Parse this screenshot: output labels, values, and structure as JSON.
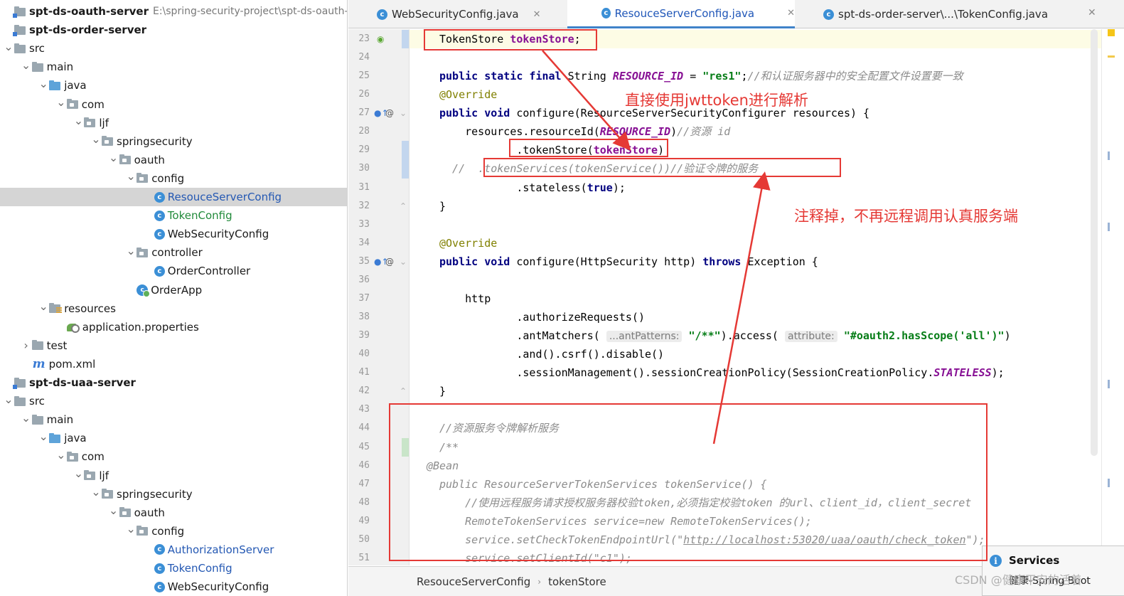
{
  "project_tree": [
    {
      "name": "spt-ds-oauth-server",
      "path": "E:\\spring-security-project\\spt-ds-oauth-serve",
      "type": "module",
      "depth": 0,
      "arrow": "",
      "bold": true
    },
    {
      "name": "spt-ds-order-server",
      "type": "module",
      "depth": 0,
      "arrow": "",
      "bold": true
    },
    {
      "name": "src",
      "type": "folder",
      "depth": 0,
      "arrow": "v"
    },
    {
      "name": "main",
      "type": "folder",
      "depth": 1,
      "arrow": "v"
    },
    {
      "name": "java",
      "type": "src",
      "depth": 2,
      "arrow": "v"
    },
    {
      "name": "com",
      "type": "pkg",
      "depth": 3,
      "arrow": "v"
    },
    {
      "name": "ljf",
      "type": "pkg",
      "depth": 4,
      "arrow": "v"
    },
    {
      "name": "springsecurity",
      "type": "pkg",
      "depth": 5,
      "arrow": "v"
    },
    {
      "name": "oauth",
      "type": "pkg",
      "depth": 6,
      "arrow": "v"
    },
    {
      "name": "config",
      "type": "pkg",
      "depth": 7,
      "arrow": "v"
    },
    {
      "name": "ResouceServerConfig",
      "type": "class",
      "depth": 8,
      "arrow": "",
      "color": "blue",
      "selected": true
    },
    {
      "name": "TokenConfig",
      "type": "class",
      "depth": 8,
      "arrow": "",
      "color": "green"
    },
    {
      "name": "WebSecurityConfig",
      "type": "class",
      "depth": 8,
      "arrow": ""
    },
    {
      "name": "controller",
      "type": "pkg",
      "depth": 7,
      "arrow": "v"
    },
    {
      "name": "OrderController",
      "type": "class",
      "depth": 8,
      "arrow": ""
    },
    {
      "name": "OrderApp",
      "type": "app",
      "depth": 7,
      "arrow": ""
    },
    {
      "name": "resources",
      "type": "res",
      "depth": 2,
      "arrow": "v"
    },
    {
      "name": "application.properties",
      "type": "props",
      "depth": 3,
      "arrow": ""
    },
    {
      "name": "test",
      "type": "folder",
      "depth": 1,
      "arrow": ">"
    },
    {
      "name": "pom.xml",
      "type": "maven",
      "depth": 1,
      "arrow": ""
    },
    {
      "name": "spt-ds-uaa-server",
      "type": "module",
      "depth": 0,
      "arrow": "",
      "bold": true
    },
    {
      "name": "src",
      "type": "folder",
      "depth": 0,
      "arrow": "v"
    },
    {
      "name": "main",
      "type": "folder",
      "depth": 1,
      "arrow": "v"
    },
    {
      "name": "java",
      "type": "src",
      "depth": 2,
      "arrow": "v"
    },
    {
      "name": "com",
      "type": "pkg",
      "depth": 3,
      "arrow": "v"
    },
    {
      "name": "ljf",
      "type": "pkg",
      "depth": 4,
      "arrow": "v"
    },
    {
      "name": "springsecurity",
      "type": "pkg",
      "depth": 5,
      "arrow": "v"
    },
    {
      "name": "oauth",
      "type": "pkg",
      "depth": 6,
      "arrow": "v"
    },
    {
      "name": "config",
      "type": "pkg",
      "depth": 7,
      "arrow": "v"
    },
    {
      "name": "AuthorizationServer",
      "type": "class",
      "depth": 8,
      "arrow": "",
      "color": "blue"
    },
    {
      "name": "TokenConfig",
      "type": "class",
      "depth": 8,
      "arrow": "",
      "color": "blue"
    },
    {
      "name": "WebSecurityConfig",
      "type": "class",
      "depth": 8,
      "arrow": ""
    }
  ],
  "tabs": [
    {
      "label": "WebSecurityConfig.java",
      "close": "✕",
      "active": false
    },
    {
      "label": "ResouceServerConfig.java",
      "close": "✕",
      "active": true
    },
    {
      "label": "spt-ds-order-server\\...\\TokenConfig.java",
      "close": "",
      "active": false
    }
  ],
  "code_lines": [
    {
      "num": "23",
      "tokens": [
        [
          "",
          "TokenStore "
        ],
        [
          "fd",
          "tokenStore"
        ],
        [
          "",
          ";"
        ]
      ]
    },
    {
      "num": "24",
      "tokens": []
    },
    {
      "num": "25",
      "tokens": [
        [
          "kw",
          "public static final "
        ],
        [
          "",
          "String "
        ],
        [
          "cn",
          "RESOURCE_ID"
        ],
        [
          "",
          " = "
        ],
        [
          "st",
          "\"res1\""
        ],
        [
          "",
          ";"
        ],
        [
          "cm",
          "//和认证服务器中的安全配置文件设置要一致"
        ]
      ]
    },
    {
      "num": "26",
      "tokens": [
        [
          "an",
          "@Override"
        ]
      ]
    },
    {
      "num": "27",
      "tokens": [
        [
          "kw",
          "public void "
        ],
        [
          "",
          "configure(ResourceServerSecurityConfigurer resources) {"
        ]
      ]
    },
    {
      "num": "28",
      "tokens": [
        [
          "",
          "    resources.resourceId("
        ],
        [
          "cn",
          "RESOURCE_ID"
        ],
        [
          "",
          ")"
        ],
        [
          "cm",
          "//资源 id"
        ]
      ]
    },
    {
      "num": "29",
      "tokens": [
        [
          "",
          "            .tokenStore("
        ],
        [
          "fd",
          "tokenStore"
        ],
        [
          "",
          ")"
        ]
      ]
    },
    {
      "num": "30",
      "tokens": [
        [
          "cm",
          "  //  .tokenServices(tokenService())//验证令牌的服务"
        ]
      ]
    },
    {
      "num": "31",
      "tokens": [
        [
          "",
          "            .stateless("
        ],
        [
          "kw",
          "true"
        ],
        [
          "",
          ");"
        ]
      ]
    },
    {
      "num": "32",
      "tokens": [
        [
          "",
          "}"
        ]
      ]
    },
    {
      "num": "33",
      "tokens": []
    },
    {
      "num": "34",
      "tokens": [
        [
          "an",
          "@Override"
        ]
      ]
    },
    {
      "num": "35",
      "tokens": [
        [
          "kw",
          "public void "
        ],
        [
          "",
          "configure(HttpSecurity http) "
        ],
        [
          "kw",
          "throws "
        ],
        [
          "",
          "Exception {"
        ]
      ]
    },
    {
      "num": "36",
      "tokens": []
    },
    {
      "num": "37",
      "tokens": [
        [
          "",
          "    http"
        ]
      ]
    },
    {
      "num": "38",
      "tokens": [
        [
          "",
          "            .authorizeRequests()"
        ]
      ]
    },
    {
      "num": "39",
      "tokens": [
        [
          "",
          "            .antMatchers( "
        ],
        [
          "hint",
          "...antPatterns:"
        ],
        [
          "",
          " "
        ],
        [
          "st",
          "\"/**\""
        ],
        [
          "",
          ").access( "
        ],
        [
          "hint",
          "attribute:"
        ],
        [
          "",
          " "
        ],
        [
          "st",
          "\"#oauth2.hasScope('all')\""
        ],
        [
          "",
          ")"
        ]
      ]
    },
    {
      "num": "40",
      "tokens": [
        [
          "",
          "            .and().csrf().disable()"
        ]
      ]
    },
    {
      "num": "41",
      "tokens": [
        [
          "",
          "            .sessionManagement().sessionCreationPolicy(SessionCreationPolicy."
        ],
        [
          "cn",
          "STATELESS"
        ],
        [
          "",
          ");"
        ]
      ]
    },
    {
      "num": "42",
      "tokens": [
        [
          "",
          "}"
        ]
      ]
    },
    {
      "num": "43",
      "tokens": []
    },
    {
      "num": "44",
      "tokens": [
        [
          "cm",
          "//资源服务令牌解析服务"
        ]
      ]
    },
    {
      "num": "45",
      "tokens": [
        [
          "cm",
          "/**"
        ]
      ]
    },
    {
      "num": "46",
      "tokens": [
        [
          "cm",
          "@Bean"
        ]
      ]
    },
    {
      "num": "47",
      "tokens": [
        [
          "cm",
          "public ResourceServerTokenServices tokenService() {"
        ]
      ]
    },
    {
      "num": "48",
      "tokens": [
        [
          "cm",
          "    //使用远程服务请求授权服务器校验token,必须指定校验token 的url、client_id，client_secret"
        ]
      ]
    },
    {
      "num": "49",
      "tokens": [
        [
          "cm",
          "    RemoteTokenServices service=new RemoteTokenServices();"
        ]
      ]
    },
    {
      "num": "50",
      "tokens": [
        [
          "cm",
          "    service.setCheckTokenEndpointUrl(\""
        ],
        [
          "url",
          "http://localhost:53020/uaa/oauth/check_token"
        ],
        [
          "cm",
          "\");"
        ]
      ]
    },
    {
      "num": "51",
      "tokens": [
        [
          "cm",
          "    service.setClientId(\"c1\");"
        ]
      ]
    }
  ],
  "annotations": {
    "jwt_note": "直接使用jwttoken进行解析",
    "comment_note": "注释掉，不再远程调用认真服务端"
  },
  "breadcrumb": [
    "ResouceServerConfig",
    "tokenStore"
  ],
  "services_popup": {
    "title": "Services",
    "body": "健康-Spring Boot"
  },
  "watermark": "CSDN @健康平安的活着",
  "colors": {
    "keyword": "#000080",
    "string": "#067d17",
    "comment": "#8c8c8c",
    "annotation": "#808000",
    "constant": "#871094",
    "highlight": "#e53935",
    "selection": "#d5d5d5"
  }
}
